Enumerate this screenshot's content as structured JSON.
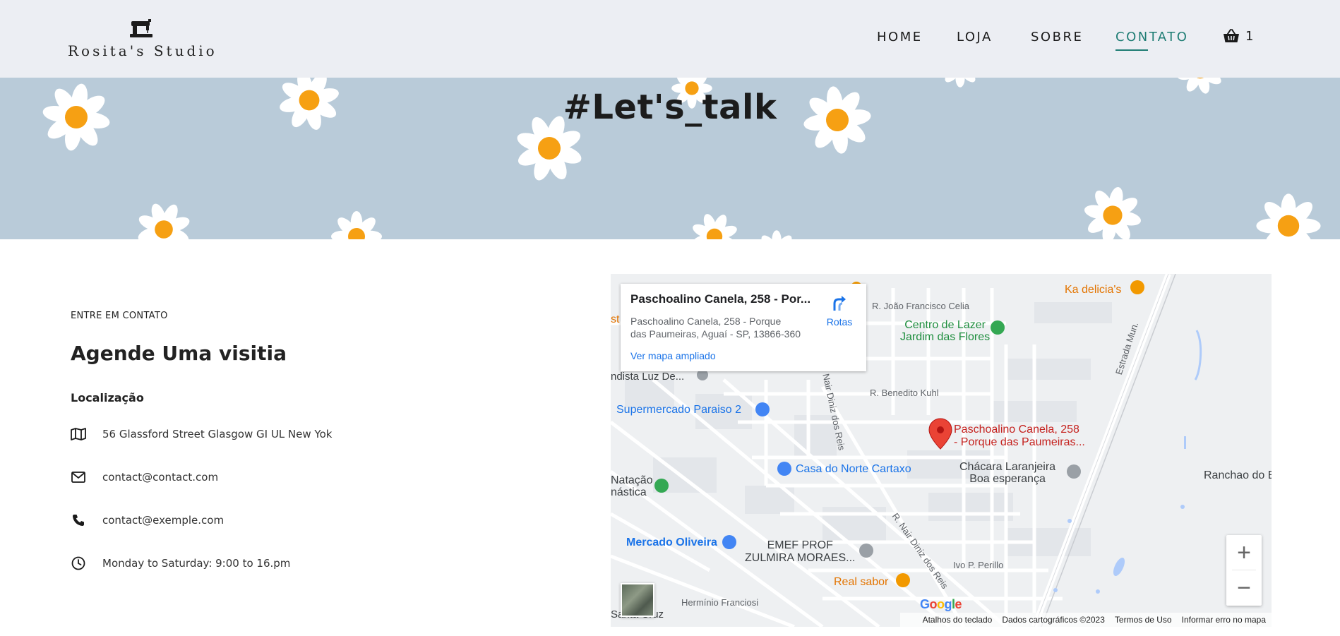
{
  "brand": {
    "name": "Rosita's Studio",
    "icon": "sewing-machine-icon"
  },
  "nav": {
    "items": [
      {
        "label": "HOME",
        "active": false
      },
      {
        "label": "LOJA",
        "active": false
      },
      {
        "label": "SOBRE",
        "active": false
      },
      {
        "label": "CONTATO",
        "active": true
      }
    ],
    "cart_icon": "basket-icon",
    "cart_count": "1"
  },
  "hero": {
    "title": "#Let's_talk",
    "background": "#b9cbd9"
  },
  "contact": {
    "eyebrow": "ENTRE EM CONTATO",
    "title": "Agende Uma visitia",
    "location_label": "Localização",
    "rows": [
      {
        "icon": "map-icon",
        "text": "56 Glassford Street Glasgow GI UL New Yok"
      },
      {
        "icon": "envelope-icon",
        "text": "contact@contact.com"
      },
      {
        "icon": "phone-icon",
        "text": "contact@exemple.com"
      },
      {
        "icon": "clock-icon",
        "text": "Monday to Saturday: 9:00 to 16.pm"
      }
    ]
  },
  "map": {
    "card": {
      "title": "Paschoalino Canela, 258 - Por...",
      "address": "Paschoalino Canela, 258 - Porque\ndas Paumeiras, Aguaí - SP, 13866-360",
      "directions_label": "Rotas",
      "enlarge_link": "Ver mapa ampliado"
    },
    "labels": {
      "ka_delicia": "Ka delicia's",
      "joao_celia": "R. João Francisco Celia",
      "centro_lazer": "Centro de Lazer\nJardim das Flores",
      "estrada": "Estrada Mun.",
      "nista": "ndista Luz De...",
      "nair_top": "Nair Diniz dos Reis",
      "benedito": "R. Benedito Kuhl",
      "supermercado": "Supermercado Paraiso 2",
      "pin_line1": "Paschoalino Canela, 258",
      "pin_line2": "- Porque das Paumeiras...",
      "casa_norte": "Casa do Norte Cartaxo",
      "chacara": "Chácara Laranjeira\nBoa esperança",
      "ranchao": "Ranchao do Elf",
      "natacao": "Natação\nnástica",
      "nair_bottom": "R. Nair Diniz dos Reis",
      "mercado": "Mercado Oliveira",
      "emef": "EMEF PROF\nZULMIRA MORAES...",
      "perillo": "Ivo P. Perillo",
      "real_sabor": "Real sabor",
      "herminio": "Hermínio Franciosi",
      "santa_cruz": "Santa Cruz",
      "st_fragment": "st"
    },
    "zoom_in": "+",
    "zoom_out": "−",
    "google": "Google",
    "attribution": {
      "keyboard": "Atalhos do teclado",
      "data": "Dados cartográficos ©2023",
      "terms": "Termos de Uso",
      "report": "Informar erro no mapa"
    }
  },
  "colors": {
    "accent": "#1f7d74",
    "header_bg": "#eceef3",
    "pin": "#ea4335"
  }
}
